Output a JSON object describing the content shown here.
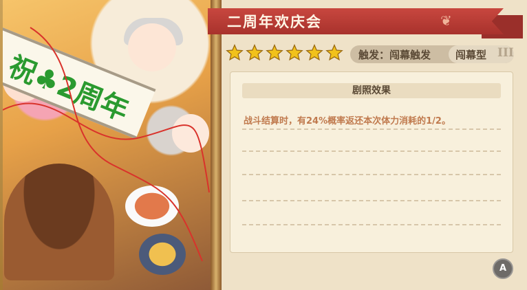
{
  "card": {
    "title": "二周年欢庆会",
    "star_count": 6,
    "star_color": "#f2c21b",
    "trigger_label": "触发：闯幕触发",
    "type_label": "闯幕型",
    "type_rank": "III",
    "art_banner": "祝♣2周年"
  },
  "effect": {
    "header": "剧照效果",
    "text": "战斗结算时，有24%概率返还本次体力消耗的1/2。"
  },
  "controls": {
    "a_button": "A"
  },
  "colors": {
    "title_bar": "#b83a33",
    "effect_text": "#c07a4e",
    "panel_bg": "#efe2c8"
  }
}
